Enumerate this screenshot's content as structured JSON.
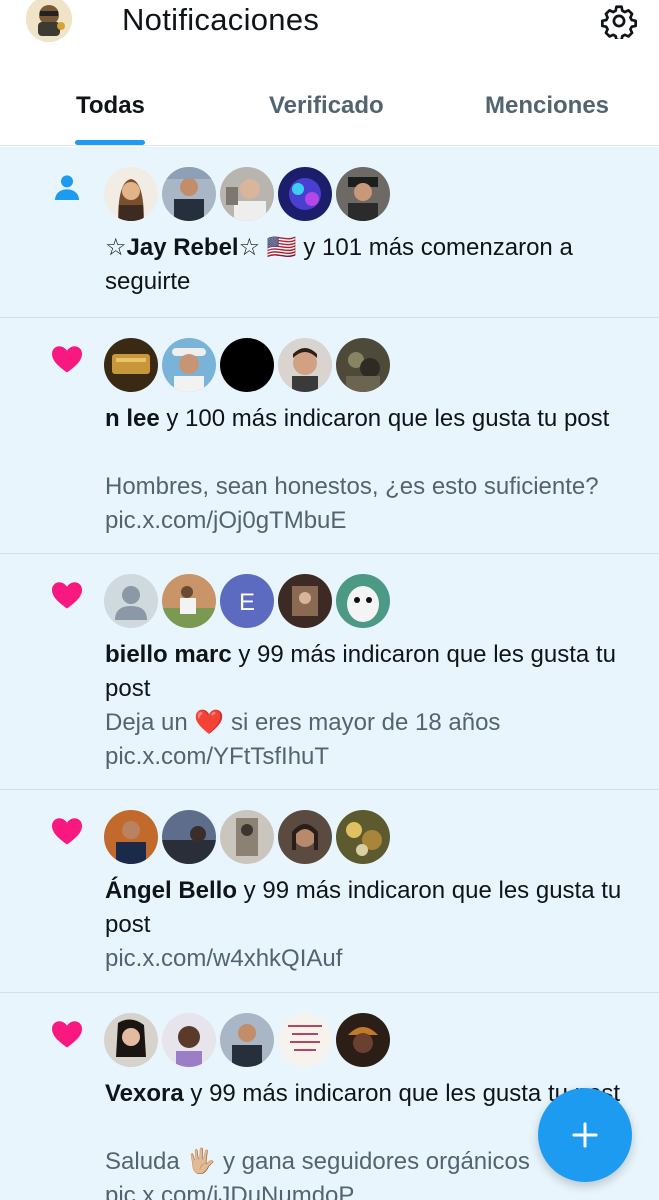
{
  "header": {
    "title": "Notificaciones",
    "profile_avatar_icon": "profile-avatar",
    "settings_icon": "gear-icon"
  },
  "tabs": [
    {
      "label": "Todas",
      "active": true
    },
    {
      "label": "Verificado",
      "active": false
    },
    {
      "label": "Menciones",
      "active": false
    }
  ],
  "notifications": [
    {
      "type": "follow",
      "icon": "person-icon",
      "name": "☆Jay Rebel☆ 🇺🇸",
      "action": " y 101 más comenzaron a seguirte",
      "preview": "",
      "link": ""
    },
    {
      "type": "like",
      "icon": "heart-icon",
      "name": "n lee",
      "action": " y 100 más indicaron que les gusta tu post",
      "preview": "Hombres, sean honestos, ¿es esto suficiente?",
      "link": "pic.x.com/jOj0gTMbuE"
    },
    {
      "type": "like",
      "icon": "heart-icon",
      "name": "biello marc",
      "action": " y 99 más indicaron que les gusta tu post",
      "preview": "Deja un ❤️ si eres mayor de 18 años",
      "link": "pic.x.com/YFtTsfIhuT"
    },
    {
      "type": "like",
      "icon": "heart-icon",
      "name": "Ángel Bello",
      "action": " y 99 más indicaron que les gusta tu post",
      "preview": "",
      "link": "pic.x.com/w4xhkQIAuf"
    },
    {
      "type": "like",
      "icon": "heart-icon",
      "name": "Vexora",
      "action": " y 99 más indicaron que les gusta tu post",
      "preview": "Saluda 🖐🏼 y gana seguidores orgánicos",
      "link": "pic.x.com/jJDuNumdoP"
    }
  ],
  "avatar_letter": "E",
  "colors": {
    "accent": "#1d9bf0",
    "like": "#f91880",
    "unread_bg": "#e8f5fd",
    "secondary_text": "#536471"
  },
  "fab": {
    "icon": "plus-icon"
  }
}
